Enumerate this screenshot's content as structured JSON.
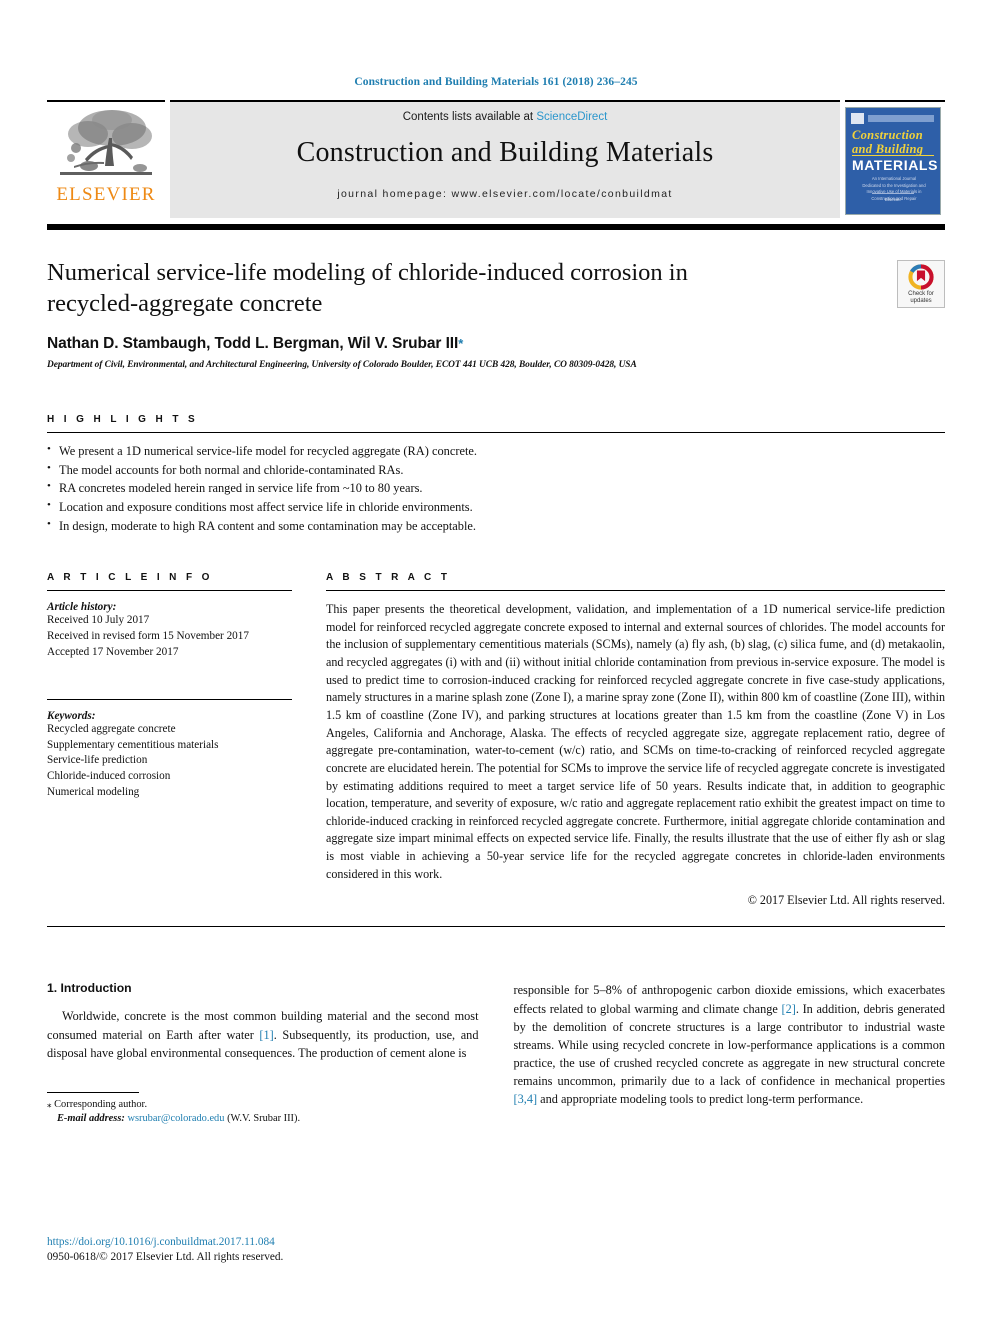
{
  "running_head": "Construction and Building Materials 161 (2018) 236–245",
  "masthead": {
    "publisher_name": "ELSEVIER",
    "contents_prefix": "Contents lists available at ",
    "sciencedirect": "ScienceDirect",
    "journal_title": "Construction and Building Materials",
    "homepage": "journal homepage: www.elsevier.com/locate/conbuildmat",
    "cover": {
      "line1": "Construction",
      "line2": "and Building",
      "line3": "MATERIALS",
      "subtitle": "An International Journal Dedicated to the Investigation and Innovative Use of Materials in Construction and Repair",
      "footer": "Elsevier"
    },
    "accent_color": "#2b96cc",
    "brand_color": "#ee8914"
  },
  "article": {
    "title": "Numerical service-life modeling of chloride-induced corrosion in recycled-aggregate concrete",
    "authors": "Nathan D. Stambaugh, Todd L. Bergman, Wil V. Srubar III",
    "author_star": "*",
    "affiliation": "Department of Civil, Environmental, and Architectural Engineering, University of Colorado Boulder, ECOT 441 UCB 428, Boulder, CO 80309-0428, USA",
    "crossmark": {
      "line1": "Check for",
      "line2": "updates"
    }
  },
  "highlights": {
    "label": "H I G H L I G H T S",
    "items": [
      "We present a 1D numerical service-life model for recycled aggregate (RA) concrete.",
      "The model accounts for both normal and chloride-contaminated RAs.",
      "RA concretes modeled herein ranged in service life from ~10 to 80 years.",
      "Location and exposure conditions most affect service life in chloride environments.",
      "In design, moderate to high RA content and some contamination may be acceptable."
    ]
  },
  "article_info": {
    "label": "A R T I C L E    I N F O",
    "history_label": "Article history:",
    "history": [
      "Received 10 July 2017",
      "Received in revised form 15 November 2017",
      "Accepted 17 November 2017"
    ],
    "keywords_label": "Keywords:",
    "keywords": [
      "Recycled aggregate concrete",
      "Supplementary cementitious materials",
      "Service-life prediction",
      "Chloride-induced corrosion",
      "Numerical modeling"
    ]
  },
  "abstract": {
    "label": "A B S T R A C T",
    "text": "This paper presents the theoretical development, validation, and implementation of a 1D numerical service-life prediction model for reinforced recycled aggregate concrete exposed to internal and external sources of chlorides. The model accounts for the inclusion of supplementary cementitious materials (SCMs), namely (a) fly ash, (b) slag, (c) silica fume, and (d) metakaolin, and recycled aggregates (i) with and (ii) without initial chloride contamination from previous in-service exposure. The model is used to predict time to corrosion-induced cracking for reinforced recycled aggregate concrete in five case-study applications, namely structures in a marine splash zone (Zone I), a marine spray zone (Zone II), within 800 km of coastline (Zone III), within 1.5 km of coastline (Zone IV), and parking structures at locations greater than 1.5 km from the coastline (Zone V) in Los Angeles, California and Anchorage, Alaska. The effects of recycled aggregate size, aggregate replacement ratio, degree of aggregate pre-contamination, water-to-cement (w/c) ratio, and SCMs on time-to-cracking of reinforced recycled aggregate concrete are elucidated herein. The potential for SCMs to improve the service life of recycled aggregate concrete is investigated by estimating additions required to meet a target service life of 50 years. Results indicate that, in addition to geographic location, temperature, and severity of exposure, w/c ratio and aggregate replacement ratio exhibit the greatest impact on time to chloride-induced cracking in reinforced recycled aggregate concrete. Furthermore, initial aggregate chloride contamination and aggregate size impart minimal effects on expected service life. Finally, the results illustrate that the use of either fly ash or slag is most viable in achieving a 50-year service life for the recycled aggregate concretes in chloride-laden environments considered in this work.",
    "copyright": "© 2017 Elsevier Ltd. All rights reserved."
  },
  "introduction": {
    "heading": "1. Introduction",
    "col_left_part1": "Worldwide, concrete is the most common building material and the second most consumed material on Earth after water ",
    "ref1": "[1]",
    "col_left_part2": ". Subsequently, its production, use, and disposal have global environmental consequences. The production of cement alone is",
    "col_right_part1": "responsible for 5–8% of anthropogenic carbon dioxide emissions, which exacerbates effects related to global warming and climate change ",
    "ref2": "[2]",
    "col_right_part2": ". In addition, debris generated by the demolition of concrete structures is a large contributor to industrial waste streams. While using recycled concrete in low-performance applications is a common practice, the use of crushed recycled concrete as aggregate in new structural concrete remains uncommon, primarily due to a lack of confidence in mechanical properties ",
    "ref34": "[3,4]",
    "col_right_part3": " and appropriate modeling tools to predict long-term performance."
  },
  "footnote": {
    "star": "⁎",
    "corresponding": "Corresponding author.",
    "email_label": "E-mail address:",
    "email": "wsrubar@colorado.edu",
    "email_owner": "(W.V. Srubar III)."
  },
  "footer": {
    "doi": "https://doi.org/10.1016/j.conbuildmat.2017.11.084",
    "issn": "0950-0618/© 2017 Elsevier Ltd. All rights reserved."
  }
}
